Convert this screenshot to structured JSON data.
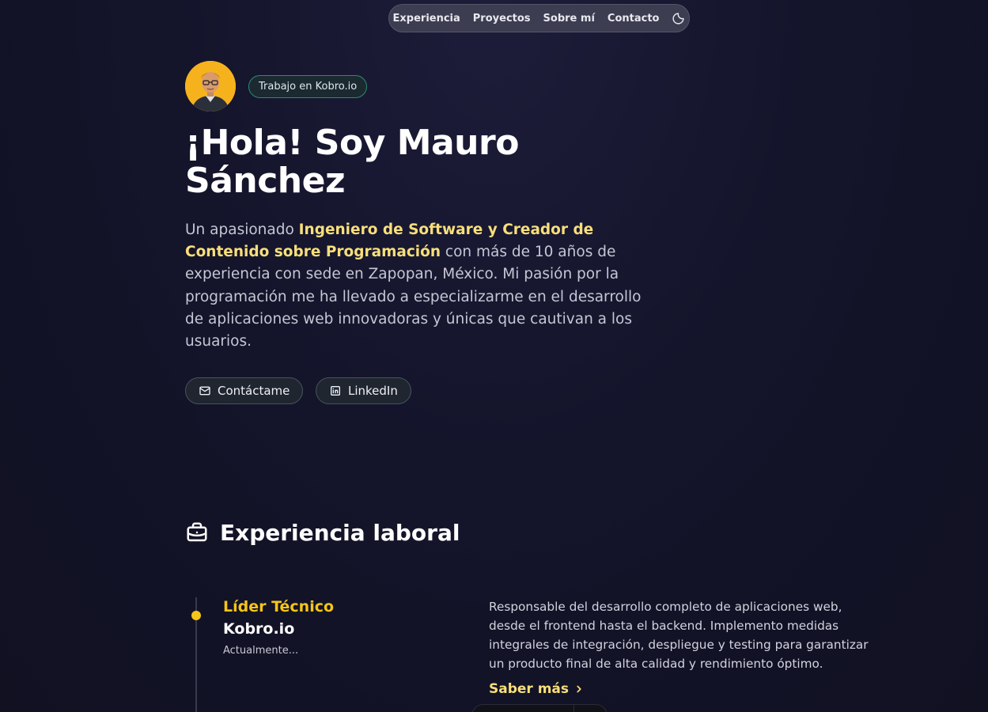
{
  "nav": {
    "items": [
      {
        "label": "Experiencia"
      },
      {
        "label": "Proyectos"
      },
      {
        "label": "Sobre mí"
      },
      {
        "label": "Contacto"
      }
    ],
    "theme_icon": "moon-icon"
  },
  "hero": {
    "badge": "Trabajo en Kobro.io",
    "title": "¡Hola! Soy Mauro Sánchez",
    "intro": {
      "before": "Un apasionado ",
      "highlight": "Ingeniero de Software y Creador de Contenido sobre Programación",
      "after": " con más de 10 años de experiencia con sede en Zapopan, México. Mi pasión por la programación me ha llevado a especializarme en el desarrollo de aplicaciones web innovadoras y únicas que cautivan a los usuarios."
    },
    "buttons": {
      "contact": {
        "label": "Contáctame",
        "icon": "mail-icon"
      },
      "linkedin": {
        "label": "LinkedIn",
        "icon": "linkedin-icon"
      }
    }
  },
  "experience": {
    "title": "Experiencia laboral",
    "icon": "briefcase-icon",
    "jobs": [
      {
        "role": "Líder Técnico",
        "company": "Kobro.io",
        "date": "Actualmente...",
        "description": "Responsable del desarrollo completo de aplicaciones web, desde el frontend hasta el backend. Implemento medidas integrales de integración, despliegue y testing para garantizar un producto final de alta calidad y rendimiento óptimo.",
        "more_label": "Saber más"
      }
    ]
  },
  "colors": {
    "accent_yellow": "#f5c518",
    "highlight_text": "#f8df7a",
    "badge_border": "#2f8a6e",
    "background": "#14142a"
  }
}
